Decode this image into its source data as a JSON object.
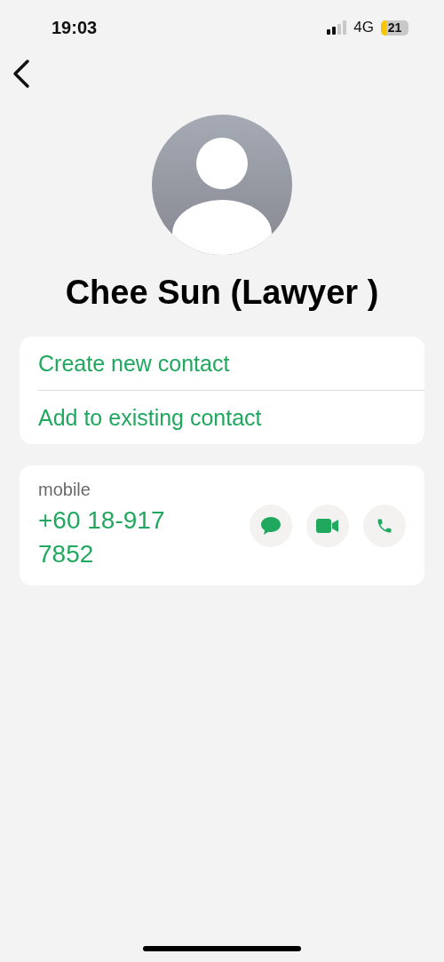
{
  "status_bar": {
    "time": "19:03",
    "network": "4G",
    "battery": "21"
  },
  "contact": {
    "name": "Chee Sun (Lawyer )"
  },
  "actions": [
    "Create new contact",
    "Add to existing contact"
  ],
  "phone": {
    "label": "mobile",
    "number": "+60 18-917 7852",
    "buttons": [
      {
        "kind": "message"
      },
      {
        "kind": "video"
      },
      {
        "kind": "call"
      }
    ]
  }
}
